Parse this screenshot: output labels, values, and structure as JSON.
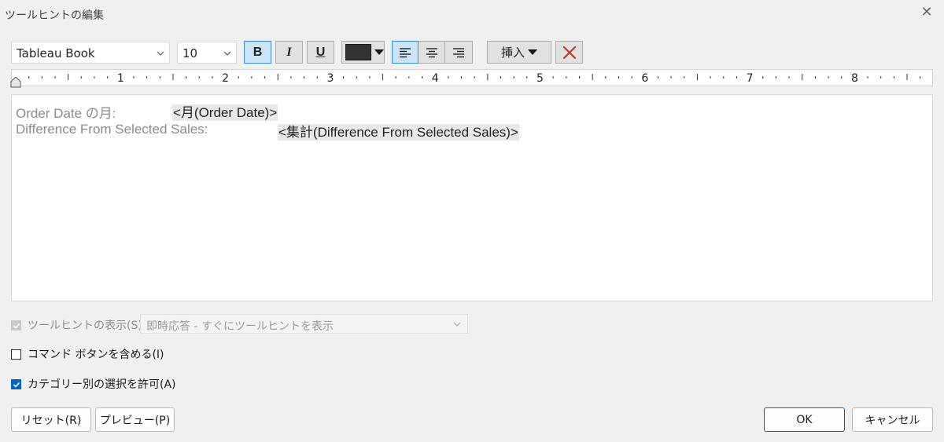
{
  "window": {
    "title": "ツールヒントの編集"
  },
  "toolbar": {
    "font_family": "Tableau Book",
    "font_size": "10",
    "bold_label": "B",
    "italic_label": "I",
    "underline_label": "U",
    "text_color": "#333333",
    "insert_label": "挿入"
  },
  "ruler": {
    "numbers": [
      "1",
      "2",
      "3",
      "4",
      "5",
      "6",
      "7",
      "8"
    ]
  },
  "editor": {
    "lines": [
      {
        "label": "Order Date の月:",
        "field": "<月(Order Date)>"
      },
      {
        "label": "Difference From Selected Sales:",
        "field": "<集計(Difference From Selected Sales)>"
      }
    ]
  },
  "options": {
    "show_tooltip": {
      "label": "ツールヒントの表示(S)",
      "checked": true,
      "enabled": false
    },
    "tooltip_mode": "即時応答 - すぐにツールヒントを表示",
    "include_commands": {
      "label": "コマンド ボタンを含める(I)",
      "checked": false
    },
    "allow_category_select": {
      "label": "カテゴリー別の選択を許可(A)",
      "checked": true
    }
  },
  "buttons": {
    "reset": "リセット(R)",
    "preview": "プレビュー(P)",
    "ok": "OK",
    "cancel": "キャンセル"
  },
  "colors": {
    "accent": "#0067c0",
    "active_bg": "#cce4f7",
    "clear_red": "#c0392b"
  }
}
